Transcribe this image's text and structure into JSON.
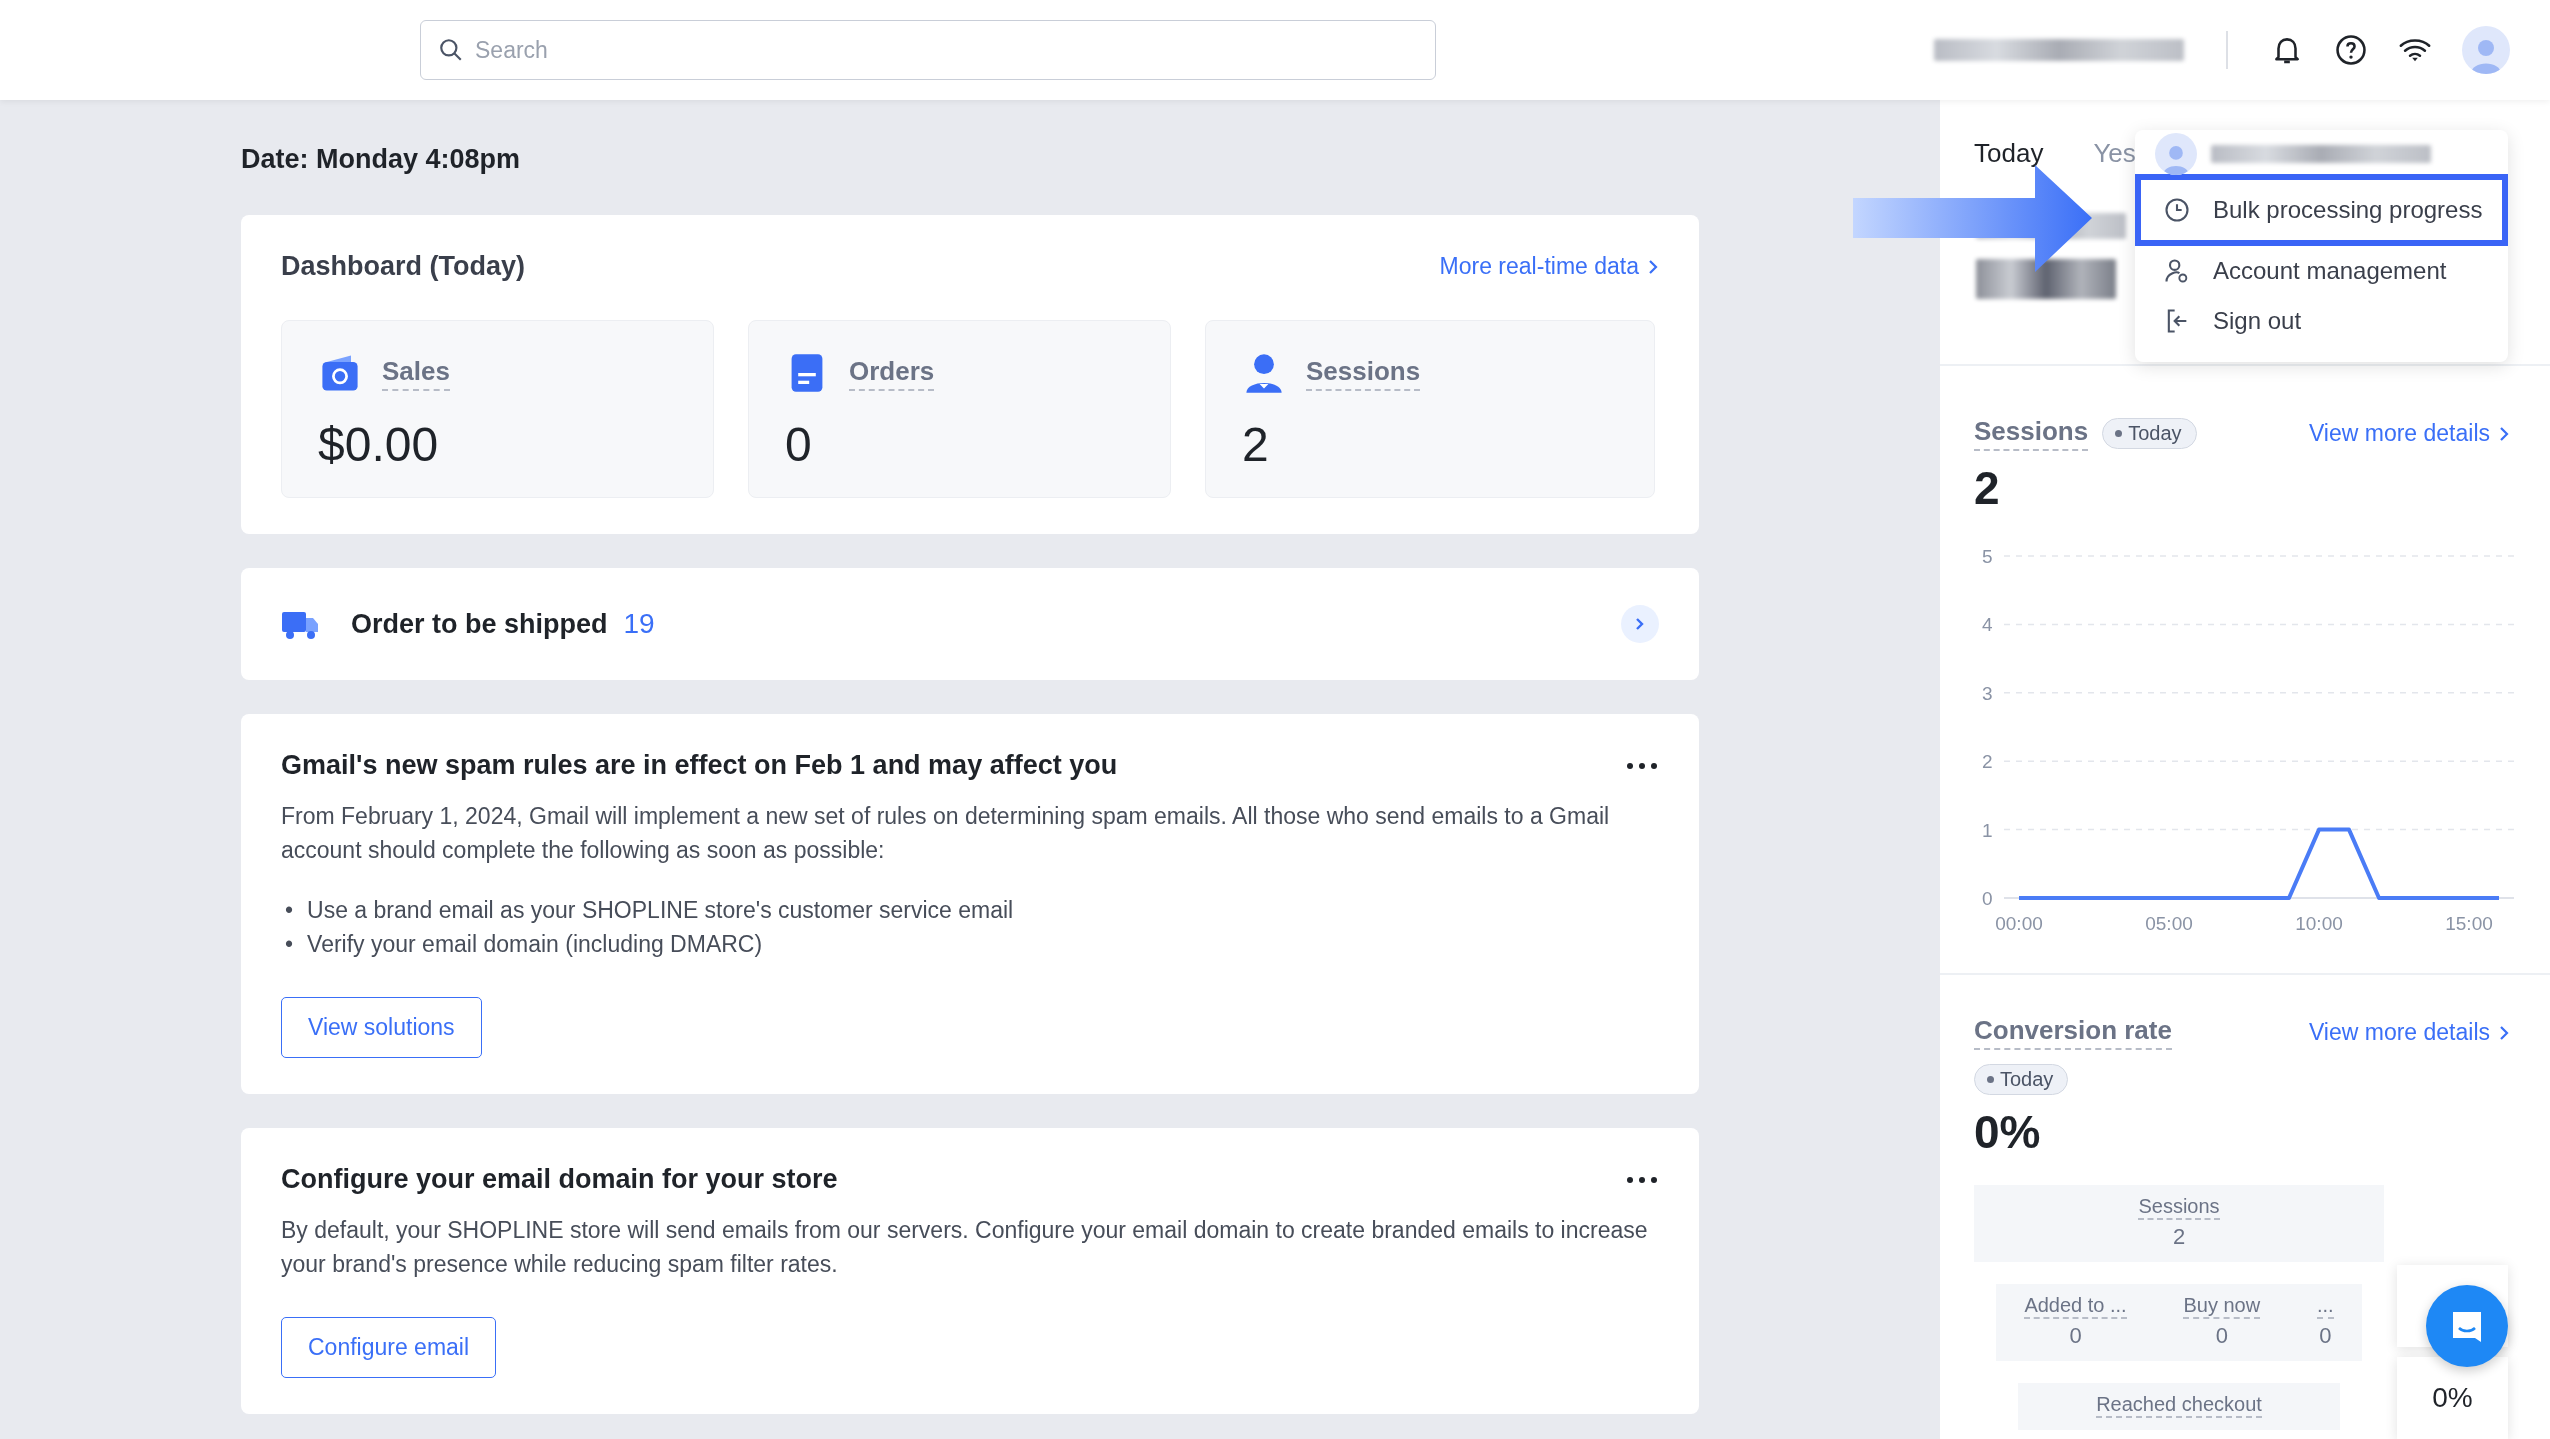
{
  "search": {
    "placeholder": "Search"
  },
  "date": "Date: Monday 4:08pm",
  "dashboard": {
    "title": "Dashboard (Today)",
    "link": "More real-time data",
    "metrics": [
      {
        "kind": "sales",
        "label": "Sales",
        "value": "$0.00"
      },
      {
        "kind": "orders",
        "label": "Orders",
        "value": "0"
      },
      {
        "kind": "sessions",
        "label": "Sessions",
        "value": "2"
      }
    ]
  },
  "shipping": {
    "label": "Order to be shipped",
    "count": "19"
  },
  "notices": [
    {
      "title": "Gmail's new spam rules are in effect on Feb 1 and may affect you",
      "body": "From February 1, 2024, Gmail will implement a new set of rules on determining spam emails. All those who send emails to a Gmail account should complete the following as soon as possible:",
      "bullets": [
        {
          "marker": "•",
          "text": "Use a brand email as your SHOPLINE store's customer service email"
        },
        {
          "marker": "•",
          "text": "Verify your email domain (including DMARC)"
        }
      ],
      "button": "View solutions"
    },
    {
      "title": "Configure your email domain for your store",
      "body": "By default, your SHOPLINE store will send emails from our servers. Configure your email domain to create branded emails to increase your brand's presence while reducing spam filter rates.",
      "button": "Configure email"
    }
  ],
  "right_panel": {
    "tabs": [
      {
        "label": "Today",
        "selected": true
      },
      {
        "label": "Yes",
        "selected": false
      }
    ],
    "sessions": {
      "title": "Sessions",
      "badge": "Today",
      "link": "View more details",
      "value": "2",
      "chart_data": {
        "type": "line",
        "x": [
          0,
          1,
          2,
          3,
          4,
          5,
          6,
          7,
          8,
          9,
          10,
          11,
          12,
          13,
          14,
          15,
          16
        ],
        "grid": true,
        "series": [
          {
            "color": "#4a7cf6",
            "values": [
              0,
              0,
              0,
              0,
              0,
              0,
              0,
              0,
              0,
              0,
              1,
              1,
              0,
              0,
              0,
              0,
              0
            ]
          }
        ],
        "xlim": [
          -0.5,
          16.5
        ],
        "ylim": [
          0,
          5
        ],
        "yticks": [
          0,
          1,
          2,
          3,
          4,
          5
        ],
        "xticks": [
          {
            "value": 0,
            "label": "00:00"
          },
          {
            "value": 5,
            "label": "05:00"
          },
          {
            "value": 10,
            "label": "10:00"
          },
          {
            "value": 15,
            "label": "15:00"
          }
        ]
      }
    },
    "conversion": {
      "title": "Conversion rate",
      "badge": "Today",
      "link": "View more details",
      "value": "0%",
      "funnel": [
        {
          "items": [
            {
              "label": "Sessions",
              "value": "2"
            }
          ]
        },
        {
          "items": [
            {
              "label": "Added to ...",
              "value": "0"
            },
            {
              "label": "Buy now",
              "value": "0"
            },
            {
              "label": "...",
              "value": "0"
            }
          ]
        },
        {
          "items": [
            {
              "label": "Reached checkout"
            }
          ]
        }
      ],
      "rates": [
        "0%"
      ]
    }
  },
  "account_menu": {
    "items": [
      {
        "kind": "clock",
        "label": "Bulk processing progress",
        "highlighted": true
      },
      {
        "kind": "account",
        "label": "Account management",
        "highlighted": false
      },
      {
        "kind": "signout",
        "label": "Sign out",
        "highlighted": false
      }
    ]
  }
}
